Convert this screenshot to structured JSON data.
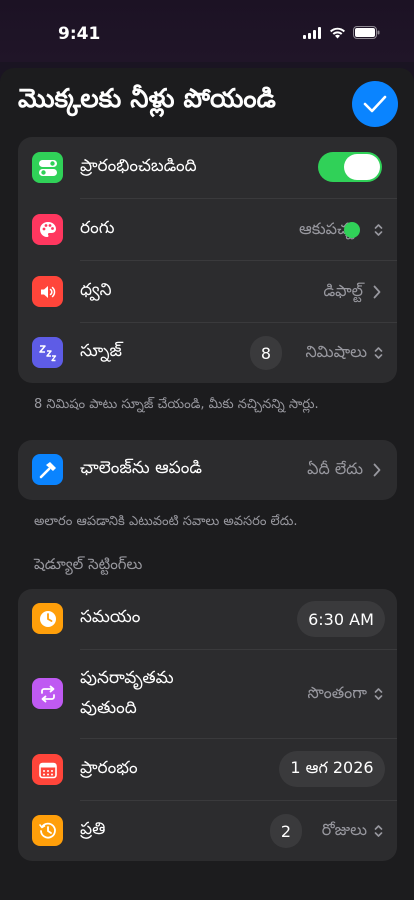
{
  "status": {
    "time": "9:41"
  },
  "header": {
    "title": "మొక్కలకు నీళ్లు పోయండి"
  },
  "colors": {
    "accent": "#0a84ff",
    "toggle_on": "#30d158",
    "color_dot": "#30d158"
  },
  "main_card": {
    "enabled": {
      "label": "ప్రారంభించబడింది",
      "on": true
    },
    "color": {
      "label": "రంగు",
      "value": "ఆకుపచ్చ"
    },
    "sound": {
      "label": "ధ్వని",
      "value": "డిఫాల్ట్"
    },
    "snooze": {
      "label": "స్నూజ్",
      "count": "8",
      "unit": "నిమిషాలు"
    }
  },
  "snooze_footnote": "8 నిమిషం పాటు స్నూజ్ చేయండి, మీకు నచ్చినన్ని సార్లు.",
  "challenge": {
    "label": "ఛాలెంజ్‌ను ఆపండి",
    "value": "ఏదీ లేదు"
  },
  "challenge_footnote": "అలారం ఆపడానికి ఎటువంటి సవాలు అవసరం లేదు.",
  "schedule": {
    "header": "షెడ్యూల్ సెట్టింగ్‌లు",
    "time": {
      "label": "సమయం",
      "value": "6:30 AM"
    },
    "repeat": {
      "label_line1": "పునరావృతమ",
      "label_line2": "వుతుంది",
      "value": "సొంతంగా"
    },
    "start": {
      "label": "ప్రారంభం",
      "value": "1 ఆగ 2026"
    },
    "every": {
      "label": "ప్రతి",
      "count": "2",
      "unit": "రోజులు"
    }
  }
}
